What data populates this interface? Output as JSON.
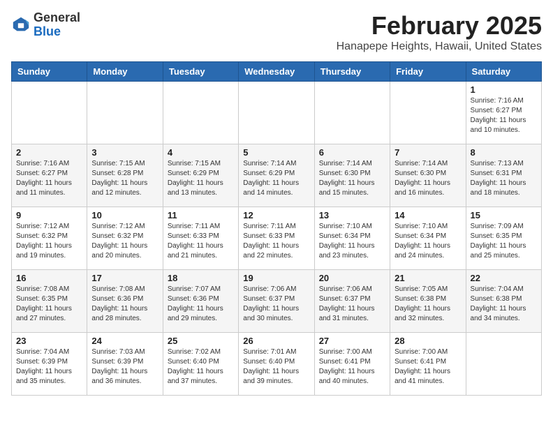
{
  "header": {
    "logo_general": "General",
    "logo_blue": "Blue",
    "month_title": "February 2025",
    "location": "Hanapepe Heights, Hawaii, United States"
  },
  "weekdays": [
    "Sunday",
    "Monday",
    "Tuesday",
    "Wednesday",
    "Thursday",
    "Friday",
    "Saturday"
  ],
  "weeks": [
    [
      {
        "day": "",
        "info": ""
      },
      {
        "day": "",
        "info": ""
      },
      {
        "day": "",
        "info": ""
      },
      {
        "day": "",
        "info": ""
      },
      {
        "day": "",
        "info": ""
      },
      {
        "day": "",
        "info": ""
      },
      {
        "day": "1",
        "info": "Sunrise: 7:16 AM\nSunset: 6:27 PM\nDaylight: 11 hours\nand 10 minutes."
      }
    ],
    [
      {
        "day": "2",
        "info": "Sunrise: 7:16 AM\nSunset: 6:27 PM\nDaylight: 11 hours\nand 11 minutes."
      },
      {
        "day": "3",
        "info": "Sunrise: 7:15 AM\nSunset: 6:28 PM\nDaylight: 11 hours\nand 12 minutes."
      },
      {
        "day": "4",
        "info": "Sunrise: 7:15 AM\nSunset: 6:29 PM\nDaylight: 11 hours\nand 13 minutes."
      },
      {
        "day": "5",
        "info": "Sunrise: 7:14 AM\nSunset: 6:29 PM\nDaylight: 11 hours\nand 14 minutes."
      },
      {
        "day": "6",
        "info": "Sunrise: 7:14 AM\nSunset: 6:30 PM\nDaylight: 11 hours\nand 15 minutes."
      },
      {
        "day": "7",
        "info": "Sunrise: 7:14 AM\nSunset: 6:30 PM\nDaylight: 11 hours\nand 16 minutes."
      },
      {
        "day": "8",
        "info": "Sunrise: 7:13 AM\nSunset: 6:31 PM\nDaylight: 11 hours\nand 18 minutes."
      }
    ],
    [
      {
        "day": "9",
        "info": "Sunrise: 7:12 AM\nSunset: 6:32 PM\nDaylight: 11 hours\nand 19 minutes."
      },
      {
        "day": "10",
        "info": "Sunrise: 7:12 AM\nSunset: 6:32 PM\nDaylight: 11 hours\nand 20 minutes."
      },
      {
        "day": "11",
        "info": "Sunrise: 7:11 AM\nSunset: 6:33 PM\nDaylight: 11 hours\nand 21 minutes."
      },
      {
        "day": "12",
        "info": "Sunrise: 7:11 AM\nSunset: 6:33 PM\nDaylight: 11 hours\nand 22 minutes."
      },
      {
        "day": "13",
        "info": "Sunrise: 7:10 AM\nSunset: 6:34 PM\nDaylight: 11 hours\nand 23 minutes."
      },
      {
        "day": "14",
        "info": "Sunrise: 7:10 AM\nSunset: 6:34 PM\nDaylight: 11 hours\nand 24 minutes."
      },
      {
        "day": "15",
        "info": "Sunrise: 7:09 AM\nSunset: 6:35 PM\nDaylight: 11 hours\nand 25 minutes."
      }
    ],
    [
      {
        "day": "16",
        "info": "Sunrise: 7:08 AM\nSunset: 6:35 PM\nDaylight: 11 hours\nand 27 minutes."
      },
      {
        "day": "17",
        "info": "Sunrise: 7:08 AM\nSunset: 6:36 PM\nDaylight: 11 hours\nand 28 minutes."
      },
      {
        "day": "18",
        "info": "Sunrise: 7:07 AM\nSunset: 6:36 PM\nDaylight: 11 hours\nand 29 minutes."
      },
      {
        "day": "19",
        "info": "Sunrise: 7:06 AM\nSunset: 6:37 PM\nDaylight: 11 hours\nand 30 minutes."
      },
      {
        "day": "20",
        "info": "Sunrise: 7:06 AM\nSunset: 6:37 PM\nDaylight: 11 hours\nand 31 minutes."
      },
      {
        "day": "21",
        "info": "Sunrise: 7:05 AM\nSunset: 6:38 PM\nDaylight: 11 hours\nand 32 minutes."
      },
      {
        "day": "22",
        "info": "Sunrise: 7:04 AM\nSunset: 6:38 PM\nDaylight: 11 hours\nand 34 minutes."
      }
    ],
    [
      {
        "day": "23",
        "info": "Sunrise: 7:04 AM\nSunset: 6:39 PM\nDaylight: 11 hours\nand 35 minutes."
      },
      {
        "day": "24",
        "info": "Sunrise: 7:03 AM\nSunset: 6:39 PM\nDaylight: 11 hours\nand 36 minutes."
      },
      {
        "day": "25",
        "info": "Sunrise: 7:02 AM\nSunset: 6:40 PM\nDaylight: 11 hours\nand 37 minutes."
      },
      {
        "day": "26",
        "info": "Sunrise: 7:01 AM\nSunset: 6:40 PM\nDaylight: 11 hours\nand 39 minutes."
      },
      {
        "day": "27",
        "info": "Sunrise: 7:00 AM\nSunset: 6:41 PM\nDaylight: 11 hours\nand 40 minutes."
      },
      {
        "day": "28",
        "info": "Sunrise: 7:00 AM\nSunset: 6:41 PM\nDaylight: 11 hours\nand 41 minutes."
      },
      {
        "day": "",
        "info": ""
      }
    ]
  ]
}
